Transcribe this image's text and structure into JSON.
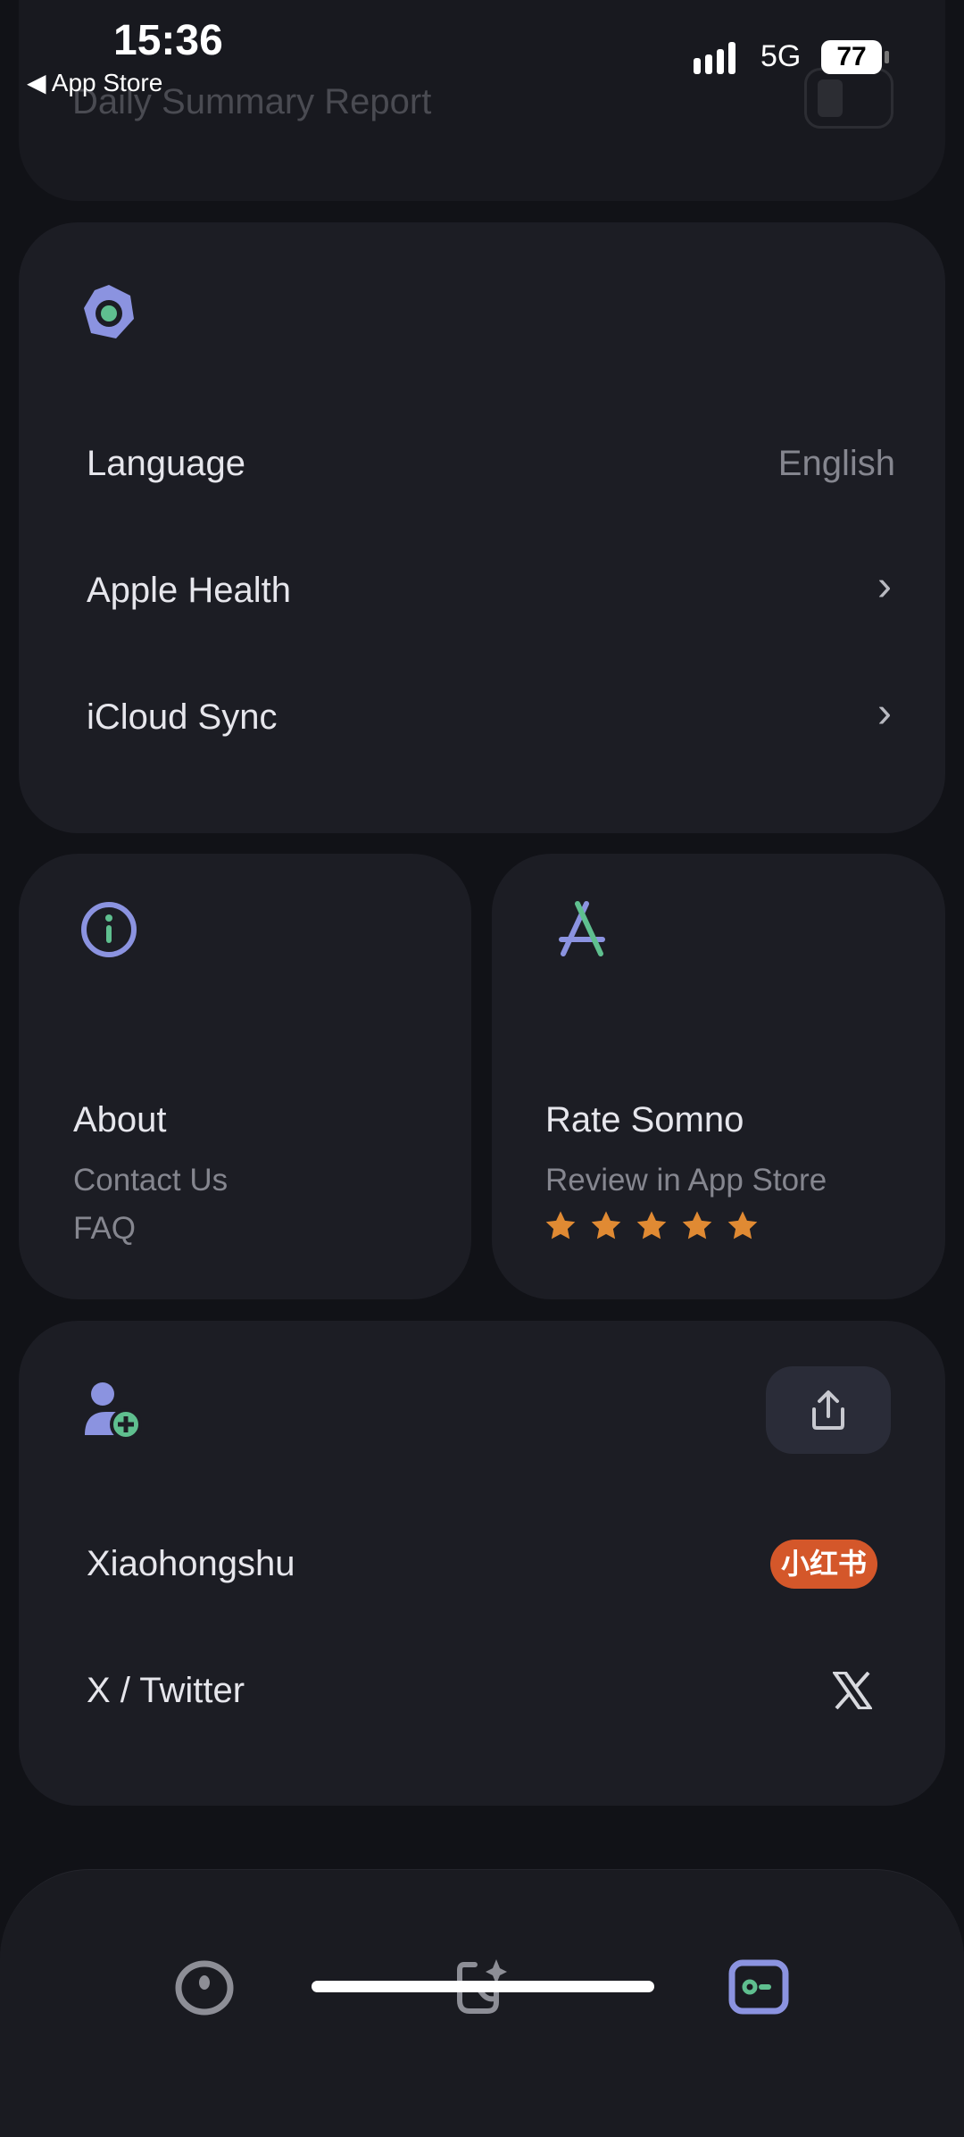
{
  "status_bar": {
    "time": "15:36",
    "back_label": "App Store",
    "network": "5G",
    "battery": "77"
  },
  "notifications_card": {
    "title": "Daily Summary Report"
  },
  "settings_card": {
    "icon": "gear-icon",
    "rows": [
      {
        "label": "Language",
        "value": "English"
      },
      {
        "label": "Apple Health",
        "chevron": "›"
      },
      {
        "label": "iCloud Sync",
        "chevron": "›"
      }
    ]
  },
  "about_card": {
    "icon": "info-icon",
    "title": "About",
    "links": [
      "Contact Us",
      "FAQ"
    ]
  },
  "rate_card": {
    "icon": "app-store-icon",
    "title": "Rate Somno",
    "subtitle": "Review in App Store",
    "rating": 5,
    "star_color": "#e08a33"
  },
  "share_card": {
    "icon": "add-user-icon",
    "share_icon": "share-icon",
    "rows": [
      {
        "label": "Xiaohongshu",
        "badge": "小红书",
        "badge_color": "#d4572a"
      },
      {
        "label": "X / Twitter",
        "icon": "x-logo-icon"
      }
    ]
  },
  "tab_bar": {
    "tabs": [
      {
        "name": "sleep",
        "icon": "sleep-tracker-icon",
        "active": false
      },
      {
        "name": "insights",
        "icon": "ai-sparkle-icon",
        "active": false
      },
      {
        "name": "settings",
        "icon": "settings-toggle-icon",
        "active": true
      }
    ]
  },
  "colors": {
    "accent": "#8b93e0",
    "accent_green": "#5fbf8f",
    "background": "#111217",
    "card": "#1c1d24"
  }
}
